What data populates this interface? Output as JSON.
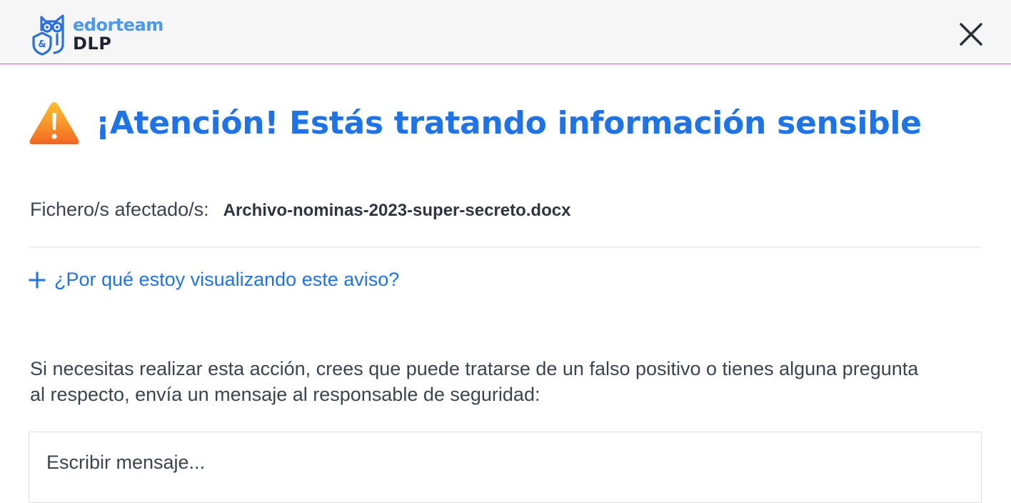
{
  "header": {
    "logo_brand": "edorteam",
    "logo_product": "DLP",
    "close_icon": "close-icon",
    "brand_color": "#4a98f2"
  },
  "alert": {
    "icon": "warning-icon",
    "title": "¡Atención! Estás tratando información sensible",
    "title_color": "#1f73e8",
    "warning_color": "#f36a24"
  },
  "affected": {
    "label": "Fichero/s afectado/s:",
    "filename": "Archivo-nominas-2023-super-secreto.docx"
  },
  "why": {
    "icon": "plus-icon",
    "label": "¿Por qué estoy visualizando este aviso?"
  },
  "message": {
    "instructions": "Si necesitas realizar esta acción, crees que puede tratarse de un falso positivo o tienes alguna pregunta al respecto, envía un mensaje al responsable de seguridad:",
    "placeholder": "Escribir mensaje..."
  }
}
